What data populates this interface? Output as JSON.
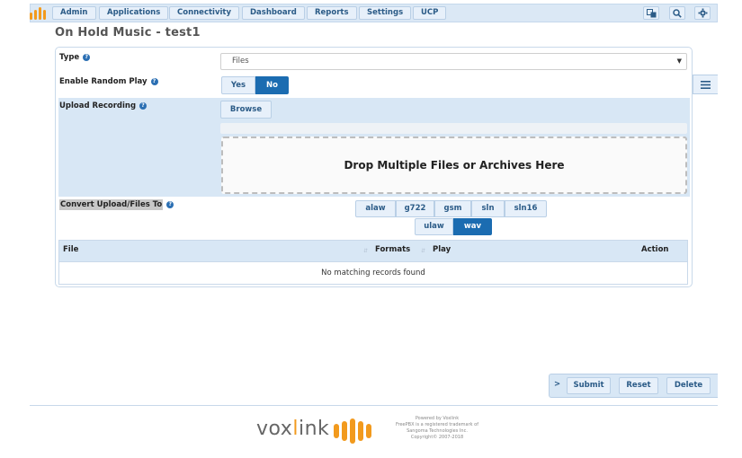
{
  "nav": {
    "items": [
      "Admin",
      "Applications",
      "Connectivity",
      "Dashboard",
      "Reports",
      "Settings",
      "UCP"
    ]
  },
  "page_title": "On Hold Music - test1",
  "form": {
    "type_label": "Type",
    "type_value": "Files",
    "random_label": "Enable Random Play",
    "random_yes": "Yes",
    "random_no": "No",
    "random_selected": "No",
    "upload_label": "Upload Recording",
    "browse_label": "Browse",
    "dropzone_text": "Drop Multiple Files or Archives Here",
    "convert_label": "Convert Upload/Files To",
    "formats": [
      "alaw",
      "g722",
      "gsm",
      "sln",
      "sln16",
      "ulaw",
      "wav"
    ],
    "selected_format": "wav"
  },
  "table": {
    "headers": [
      "File",
      "Formats",
      "Play",
      "Action"
    ],
    "empty_text": "No matching records found"
  },
  "actions": {
    "toggle": ">",
    "submit": "Submit",
    "reset": "Reset",
    "delete": "Delete"
  },
  "footer": {
    "brand_pre": "vox",
    "brand_l": "l",
    "brand_post": "ink",
    "credit_1": "Powered by Voxlink",
    "credit_2": "FreePBX is a registered trademark of",
    "credit_3": "Sangoma Technologies Inc.",
    "credit_4": "Copyright© 2007-2018"
  },
  "colors": {
    "accent": "#1b6cb1",
    "panel_bg": "#d8e7f5",
    "brand_orange": "#f29a1d"
  }
}
